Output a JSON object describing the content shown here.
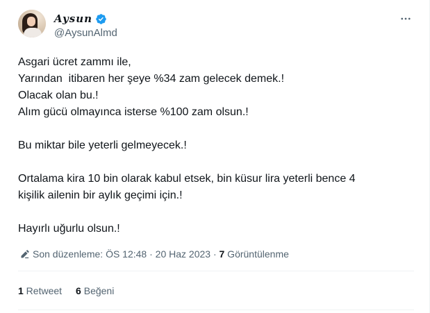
{
  "author": {
    "display_name": "Aysun",
    "handle": "@AysunAlmd",
    "verified": true,
    "avatar_icon": "profile-photo"
  },
  "tweet": {
    "lines": [
      "Asgari ücret zammı ile,",
      "Yarından  itibaren her şeye %34 zam gelecek demek.!",
      "Olacak olan bu.!",
      "Alım gücü olmayınca isterse %100 zam olsun.!",
      "",
      "Bu miktar bile yeterli gelmeyecek.!",
      "",
      "Ortalama kira 10 bin olarak kabul etsek, bin küsur lira yeterli bence 4",
      "kişilik ailenin bir aylık geçimi için.!",
      "",
      "Hayırlı uğurlu olsun.!"
    ]
  },
  "meta": {
    "edited_label": "Son düzenleme: ÖS 12:48 · 20 Haz 2023 · ",
    "views_count": "7",
    "views_label": " Görüntülenme"
  },
  "stats": {
    "retweets_count": "1",
    "retweets_label": " Retweet",
    "likes_count": "6",
    "likes_label": " Beğeni"
  },
  "colors": {
    "verified_blue": "#1d9bf0",
    "secondary_text": "#536471",
    "primary_text": "#0f1419",
    "divider": "#eff3f4"
  },
  "icons": {
    "more": "more-horizontal-icon",
    "edit": "pencil-edit-icon",
    "verified": "verified-badge-icon"
  }
}
